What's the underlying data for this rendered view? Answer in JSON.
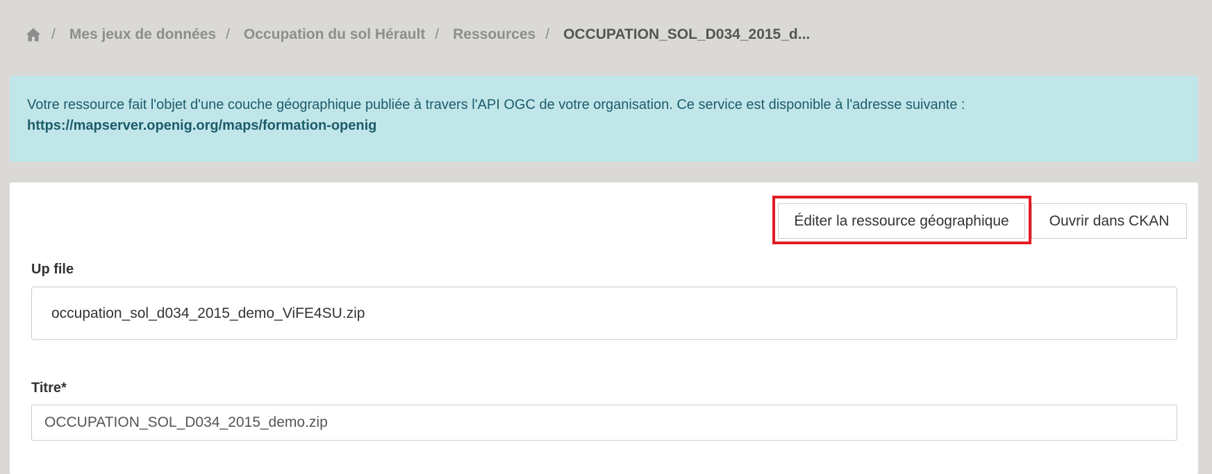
{
  "breadcrumb": {
    "home_icon": "home-icon",
    "separator": "/",
    "items": [
      {
        "label": "Mes jeux de données"
      },
      {
        "label": "Occupation du sol Hérault"
      },
      {
        "label": "Ressources"
      }
    ],
    "current": "OCCUPATION_SOL_D034_2015_d..."
  },
  "alert": {
    "message": "Votre ressource fait l'objet d'une couche géographique publiée à travers l'API OGC de votre organisation. Ce service est disponible à l'adresse suivante :",
    "link": "https://mapserver.openig.org/maps/formation-openig"
  },
  "actions": {
    "edit_geo_label": "Éditer la ressource géographique",
    "open_ckan_label": "Ouvrir dans CKAN"
  },
  "form": {
    "upfile_label": "Up file",
    "upfile_value": "occupation_sol_d034_2015_demo_ViFE4SU.zip",
    "titre_label": "Titre*",
    "titre_value": "OCCUPATION_SOL_D034_2015_demo.zip"
  },
  "colors": {
    "page_background": "#dbd9d6",
    "alert_background": "#c0e6e9",
    "alert_text": "#1d5b6a",
    "highlight": "#e31b23"
  }
}
